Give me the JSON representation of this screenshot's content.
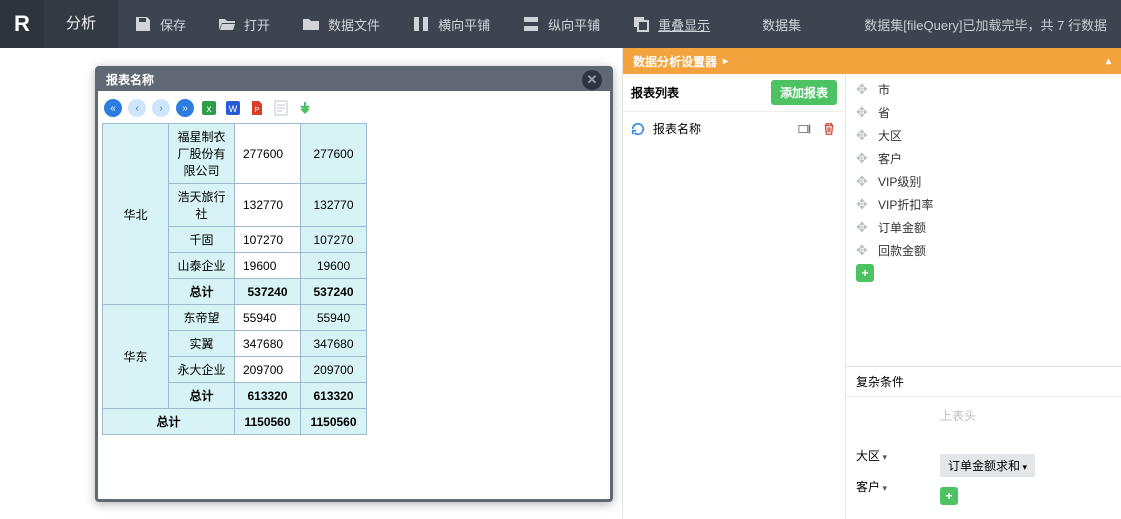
{
  "app": {
    "logo_letter": "R",
    "active_tab": "分析"
  },
  "toolbar": {
    "save": "保存",
    "open": "打开",
    "datafile": "数据文件",
    "tile_h": "横向平铺",
    "tile_v": "纵向平铺",
    "overlap": "重叠显示",
    "dataset": "数据集",
    "status": "数据集[fileQuery]已加载完毕，共 7 行数据"
  },
  "dialog": {
    "title": "报表名称"
  },
  "pivot": {
    "groups": [
      {
        "region": "华北",
        "rows": [
          {
            "cust": "福星制衣厂股份有限公司",
            "a": "277600",
            "b": "277600"
          },
          {
            "cust": "浩天旅行社",
            "a": "132770",
            "b": "132770"
          },
          {
            "cust": "千固",
            "a": "107270",
            "b": "107270"
          },
          {
            "cust": "山泰企业",
            "a": "19600",
            "b": "19600"
          }
        ],
        "subtotal": {
          "label": "总计",
          "a": "537240",
          "b": "537240"
        }
      },
      {
        "region": "华东",
        "rows": [
          {
            "cust": "东帝望",
            "a": "55940",
            "b": "55940"
          },
          {
            "cust": "实翼",
            "a": "347680",
            "b": "347680"
          },
          {
            "cust": "永大企业",
            "a": "209700",
            "b": "209700"
          }
        ],
        "subtotal": {
          "label": "总计",
          "a": "613320",
          "b": "613320"
        }
      }
    ],
    "grand": {
      "label": "总计",
      "a": "1150560",
      "b": "1150560"
    }
  },
  "analyzer": {
    "title": "数据分析设置器",
    "list_title": "报表列表",
    "add_report": "添加报表",
    "report_name": "报表名称",
    "fields": [
      "市",
      "省",
      "大区",
      "客户",
      "VIP级别",
      "VIP折扣率",
      "订单金额",
      "回款金额"
    ],
    "cond_title": "复杂条件",
    "cond_top_placeholder": "上表头",
    "dims": [
      "大区",
      "客户"
    ],
    "metric": "订单金额求和"
  }
}
